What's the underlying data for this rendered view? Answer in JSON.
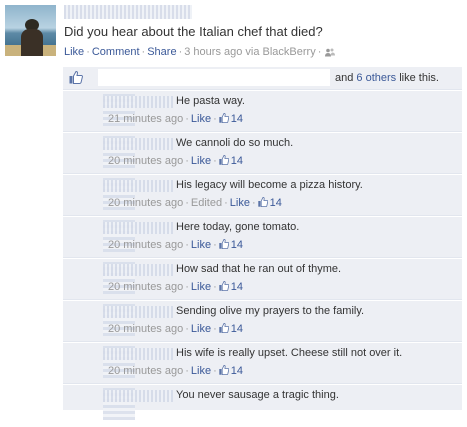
{
  "post": {
    "status_text": "Did you hear about the Italian chef that died?",
    "like_label": "Like",
    "comment_label": "Comment",
    "share_label": "Share",
    "timestamp": "3 hours ago via BlackBerry"
  },
  "likes": {
    "summary_prefix": "and",
    "others_link": "6 others",
    "summary_suffix": "like this."
  },
  "comments": [
    {
      "text": "He pasta way.",
      "time": "21 minutes ago",
      "like_label": "Like",
      "like_count": "14",
      "edited_label": ""
    },
    {
      "text": "We cannoli do so much.",
      "time": "20 minutes ago",
      "like_label": "Like",
      "like_count": "14",
      "edited_label": ""
    },
    {
      "text": "His legacy will become a pizza history.",
      "time": "20 minutes ago",
      "like_label": "Like",
      "like_count": "14",
      "edited_label": "Edited"
    },
    {
      "text": "Here today, gone tomato.",
      "time": "20 minutes ago",
      "like_label": "Like",
      "like_count": "14",
      "edited_label": ""
    },
    {
      "text": "How sad that he ran out of thyme.",
      "time": "20 minutes ago",
      "like_label": "Like",
      "like_count": "14",
      "edited_label": ""
    },
    {
      "text": "Sending olive my prayers to the family.",
      "time": "20 minutes ago",
      "like_label": "Like",
      "like_count": "14",
      "edited_label": ""
    },
    {
      "text": "His wife is really upset. Cheese still not over it.",
      "time": "20 minutes ago",
      "like_label": "Like",
      "like_count": "14",
      "edited_label": ""
    },
    {
      "text": "You never sausage a tragic thing.",
      "time": "",
      "like_label": "",
      "like_count": "",
      "edited_label": ""
    }
  ],
  "colors": {
    "link": "#3b5998",
    "meta": "#999999",
    "ufi_bg": "#edeff4"
  },
  "icons": [
    "profile-photo",
    "friends-privacy-icon",
    "thumbs-up-icon"
  ]
}
